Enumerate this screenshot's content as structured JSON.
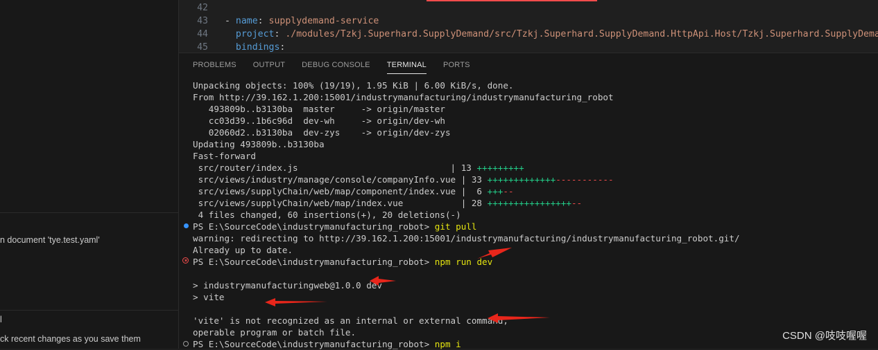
{
  "sidebar": {
    "item1_text": "n document 'tye.test.yaml'",
    "item2_text": "l",
    "item3_text": "ck recent changes as you save them"
  },
  "editor": {
    "lines": [
      {
        "num": "42",
        "dash": "",
        "key": "",
        "colon": "",
        "value": ""
      },
      {
        "num": "43",
        "dash": "- ",
        "key": "name",
        "colon": ": ",
        "value": "supplydemand-service"
      },
      {
        "num": "44",
        "dash": "  ",
        "key": "project",
        "colon": ": ",
        "value": "./modules/Tzkj.Superhard.SupplyDemand/src/Tzkj.Superhard.SupplyDemand.HttpApi.Host/Tzkj.Superhard.SupplyDemand.H"
      },
      {
        "num": "45",
        "dash": "  ",
        "key": "bindings",
        "colon": ":",
        "value": ""
      }
    ]
  },
  "panel": {
    "tabs": [
      {
        "label": "PROBLEMS",
        "active": false
      },
      {
        "label": "OUTPUT",
        "active": false
      },
      {
        "label": "DEBUG CONSOLE",
        "active": false
      },
      {
        "label": "TERMINAL",
        "active": true
      },
      {
        "label": "PORTS",
        "active": false
      }
    ]
  },
  "terminal": {
    "l1": "Unpacking objects: 100% (19/19), 1.95 KiB | 6.00 KiB/s, done.",
    "l2": "From http://39.162.1.200:15001/industrymanufacturing/industrymanufacturing_robot",
    "l3": "   493809b..b3130ba  master     -> origin/master",
    "l4": "   cc03d39..1b6c96d  dev-wh     -> origin/dev-wh",
    "l5": "   02060d2..b3130ba  dev-zys    -> origin/dev-zys",
    "l6": "Updating 493809b..b3130ba",
    "l7": "Fast-forward",
    "diff": [
      {
        "file": " src/router/index.js                             ",
        "count": "| 13 ",
        "plus": "+++++++++",
        "minus": ""
      },
      {
        "file": " src/views/industry/manage/console/companyInfo.vue ",
        "count": "| 33 ",
        "plus": "+++++++++++++",
        "minus": "-----------"
      },
      {
        "file": " src/views/supplyChain/web/map/component/index.vue ",
        "count": "|  6 ",
        "plus": "+++",
        "minus": "--"
      },
      {
        "file": " src/views/supplyChain/web/map/index.vue           ",
        "count": "| 28 ",
        "plus": "++++++++++++++++",
        "minus": "--"
      }
    ],
    "summary": " 4 files changed, 60 insertions(+), 20 deletions(-)",
    "prompt1": "PS E:\\SourceCode\\industrymanufacturing_robot> ",
    "cmd1": "git pull",
    "warn": "warning: redirecting to http://39.162.1.200:15001/industrymanufacturing/industrymanufacturing_robot.git/",
    "uptodate": "Already up to date.",
    "prompt2": "PS E:\\SourceCode\\industrymanufacturing_robot> ",
    "cmd2": "npm run dev",
    "run1": "> industrymanufacturingweb@1.0.0 dev",
    "run2": "> vite",
    "err1": "'vite' is not recognized as an internal or external command,",
    "err2": "operable program or batch file.",
    "prompt3": "PS E:\\SourceCode\\industrymanufacturing_robot> ",
    "cmd3": "npm i"
  },
  "watermark": "CSDN @吱吱喔喔",
  "colors": {
    "annotation_arrow": "#e8261b",
    "success": "#23d18b",
    "error": "#f14c4c",
    "command": "#e5e510"
  }
}
